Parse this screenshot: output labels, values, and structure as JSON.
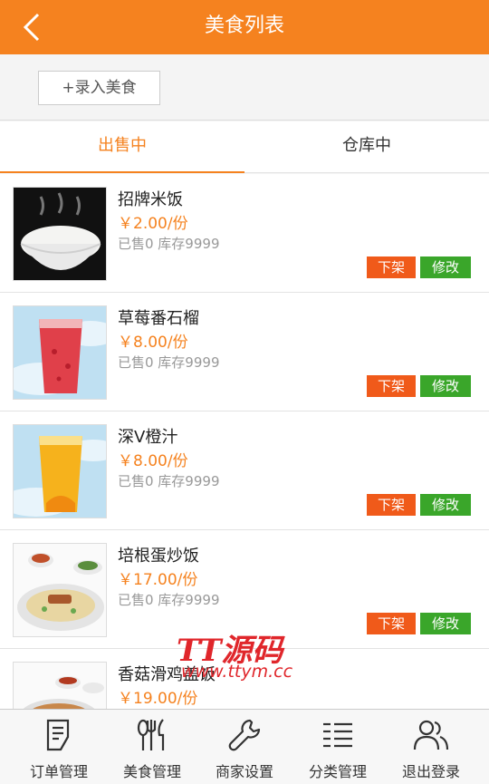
{
  "header": {
    "title": "美食列表",
    "back_icon": "chevron-left-icon"
  },
  "action": {
    "add_label": "+录入美食"
  },
  "tabs": [
    {
      "label": "出售中",
      "active": true
    },
    {
      "label": "仓库中",
      "active": false
    }
  ],
  "items": [
    {
      "name": "招牌米饭",
      "price": "￥2.00/份",
      "stock": "已售0 库存9999",
      "off_label": "下架",
      "edit_label": "修改",
      "image": "rice-bowl"
    },
    {
      "name": "草莓番石榴",
      "price": "￥8.00/份",
      "stock": "已售0 库存9999",
      "off_label": "下架",
      "edit_label": "修改",
      "image": "strawberry-guava-drink"
    },
    {
      "name": "深V橙汁",
      "price": "￥8.00/份",
      "stock": "已售0 库存9999",
      "off_label": "下架",
      "edit_label": "修改",
      "image": "orange-juice"
    },
    {
      "name": "培根蛋炒饭",
      "price": "￥17.00/份",
      "stock": "已售0 库存9999",
      "off_label": "下架",
      "edit_label": "修改",
      "image": "bacon-fried-rice"
    },
    {
      "name": "香菇滑鸡盖饭",
      "price": "￥19.00/份",
      "stock": "",
      "off_label": "",
      "edit_label": "",
      "image": "mushroom-chicken-rice"
    }
  ],
  "watermark": {
    "logo": "TT源码",
    "url": "www.ttym.cc"
  },
  "nav": [
    {
      "label": "订单管理",
      "icon": "order-icon"
    },
    {
      "label": "美食管理",
      "icon": "utensils-icon"
    },
    {
      "label": "商家设置",
      "icon": "wrench-icon"
    },
    {
      "label": "分类管理",
      "icon": "category-list-icon"
    },
    {
      "label": "退出登录",
      "icon": "users-icon"
    }
  ],
  "colors": {
    "brand": "#f5821f",
    "off_button": "#f05a1a",
    "edit_button": "#3aa62a"
  }
}
